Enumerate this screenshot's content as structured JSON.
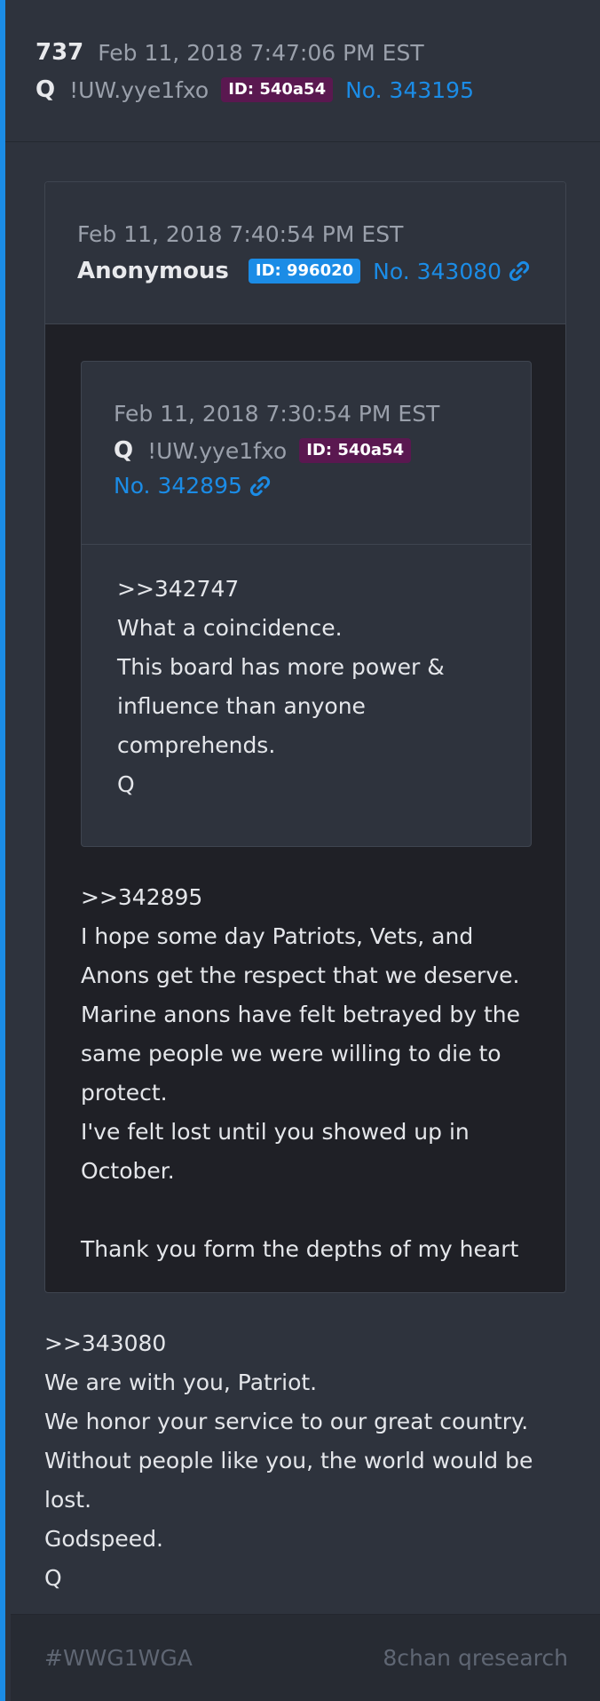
{
  "post": {
    "number": "737",
    "date": "Feb 11, 2018 7:47:06 PM EST",
    "name": "Q",
    "tripcode": "!UW.yye1fxo",
    "id_badge": "ID: 540a54",
    "post_no": "No. 343195"
  },
  "quote_outer": {
    "date": "Feb 11, 2018 7:40:54 PM EST",
    "name": "Anonymous",
    "id_badge": "ID: 996020",
    "post_no": "No. 343080",
    "body": [
      ">>342895",
      "I hope some day Patriots, Vets, and",
      "Anons get the respect that we deserve.",
      "Marine anons have felt betrayed by the",
      "same people we were willing to die to",
      "protect.",
      "I've felt lost until you showed up in",
      "October.",
      "",
      "Thank you form the depths of my heart"
    ]
  },
  "quote_inner": {
    "date": "Feb 11, 2018 7:30:54 PM EST",
    "name": "Q",
    "tripcode": "!UW.yye1fxo",
    "id_badge": "ID: 540a54",
    "post_no": "No. 342895",
    "body": [
      ">>342747",
      "What a coincidence.",
      "This board has more power &",
      "influence than anyone",
      "comprehends.",
      "Q"
    ]
  },
  "message": [
    ">>343080",
    "We are with you, Patriot.",
    "We honor your service to our great country.",
    "Without people like you, the world would be",
    "lost.",
    "Godspeed.",
    "Q"
  ],
  "footer": {
    "hashtag": "#WWG1WGA",
    "source": "8chan qresearch"
  },
  "colors": {
    "accent": "#1b8ce6",
    "id_purple": "#5a1850",
    "background": "#2e333d"
  }
}
